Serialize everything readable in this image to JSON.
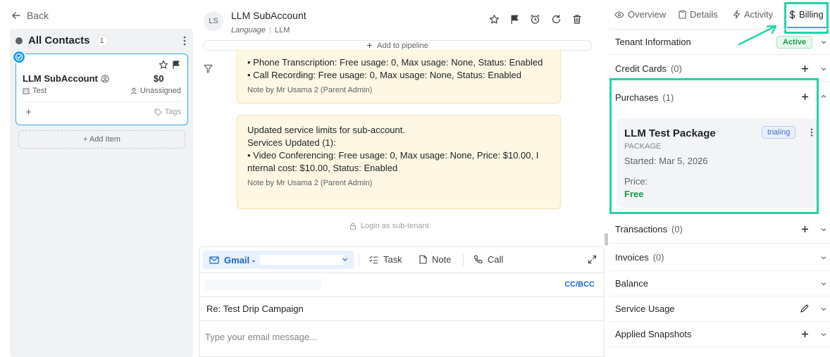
{
  "left": {
    "back_label": "Back",
    "board_title": "All Contacts",
    "board_count": "1",
    "card": {
      "name": "LLM SubAccount",
      "amount": "$0",
      "company": "Test",
      "owner": "Unassigned",
      "tags_label": "Tags",
      "plus": "+"
    },
    "add_item_label": "+ Add Item"
  },
  "middle": {
    "avatar_initials": "LS",
    "title": "LLM SubAccount",
    "subtitle_label": "Language",
    "subtitle_value": "LLM",
    "add_pipeline_label": "Add to pipeline",
    "note1": {
      "lines": [
        "• Phone Transcription: Free usage: 0, Max usage: None, Status: Enabled",
        "• Call Recording: Free usage: 0, Max usage: None, Status: Enabled"
      ],
      "meta": "Note by Mr Usama 2 (Parent Admin)"
    },
    "note2": {
      "lines": [
        "Updated service limits for sub-account.",
        "",
        "Services Updated (1):",
        "• Video Conferencing: Free usage: 0, Max usage: None, Price: $10.00, I",
        "nternal cost: $10.00, Status: Enabled"
      ],
      "meta": "Note by Mr Usama 2 (Parent Admin)"
    },
    "login_sub_label": "Login as sub-tenant",
    "composer": {
      "gmail_label": "Gmail -",
      "task_label": "Task",
      "note_label": "Note",
      "call_label": "Call",
      "ccbcc_label": "CC/BCC",
      "subject": "Re: Test Drip Campaign",
      "message_placeholder": "Type your email message..."
    }
  },
  "right": {
    "tabs": {
      "overview": "Overview",
      "details": "Details",
      "activity": "Activity",
      "billing": "Billing"
    },
    "sections": {
      "tenant_info": {
        "title": "Tenant Information",
        "status": "Active"
      },
      "credit_cards": {
        "title": "Credit Cards",
        "count": "(0)"
      },
      "purchases": {
        "title": "Purchases",
        "count": "(1)"
      },
      "transactions": {
        "title": "Transactions",
        "count": "(0)"
      },
      "invoices": {
        "title": "Invoices",
        "count": "(0)"
      },
      "balance": {
        "title": "Balance"
      },
      "service_usage": {
        "title": "Service Usage"
      },
      "applied_snapshots": {
        "title": "Applied Snapshots"
      }
    },
    "package": {
      "name": "LLM Test Package",
      "type": "PACKAGE",
      "started": "Started: Mar 5, 2026",
      "price_label": "Price:",
      "price_value": "Free",
      "status": "trialing"
    }
  },
  "colors": {
    "annotation": "#22d4a8",
    "accent_blue": "#1a66c9",
    "success_green": "#1e9a4f",
    "note_bg": "#fdf7e3",
    "card_border": "#35a7e8"
  }
}
